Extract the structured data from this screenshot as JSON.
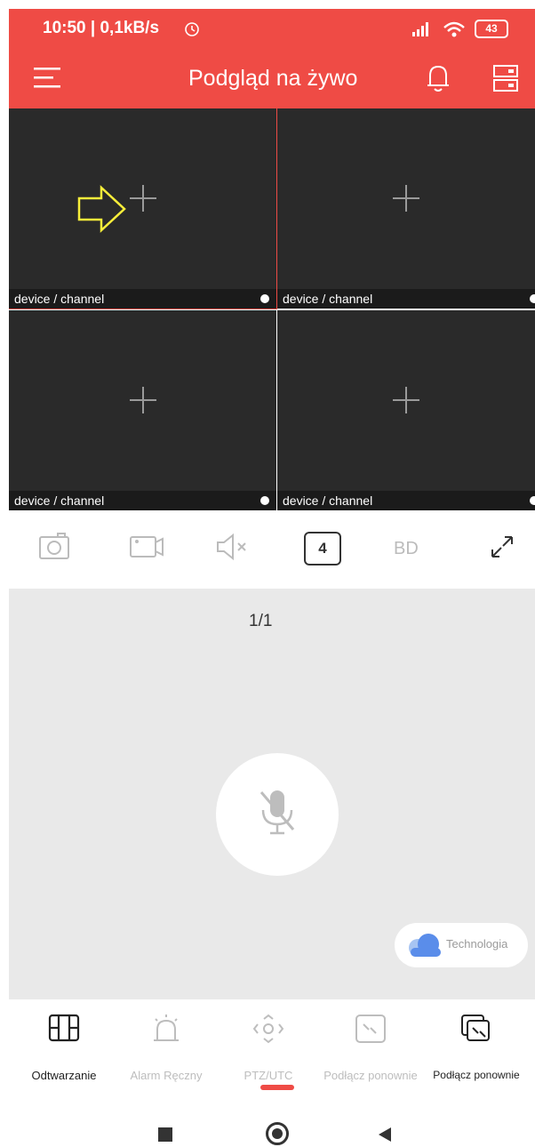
{
  "status_bar": {
    "time": "10:50 | 0,1kB/s",
    "battery": "43"
  },
  "app_bar": {
    "title": "Podgląd na żywo"
  },
  "grid": {
    "cells": [
      {
        "label": "device / channel"
      },
      {
        "label": "device / channel"
      },
      {
        "label": "device / channel"
      },
      {
        "label": "device / channel"
      }
    ]
  },
  "toolbar": {
    "split_count": "4",
    "quality": "BD"
  },
  "main": {
    "page_indicator": "1/1",
    "technology_label": "Technologia"
  },
  "bottom_nav": {
    "items": [
      {
        "label": "Odtwarzanie",
        "icon": "film-icon"
      },
      {
        "label": "Alarm Ręczny",
        "icon": "alarm-icon"
      },
      {
        "label": "PTZ/UTC",
        "icon": "ptz-icon"
      },
      {
        "label": "Podłącz ponownie",
        "icon": "link-icon"
      },
      {
        "label": "Podłącz ponownie",
        "icon": "reconnect-icon"
      }
    ]
  },
  "colors": {
    "accent": "#ef4b45",
    "cell_bg": "#2a2a2a",
    "arrow": "#f7ee3a"
  }
}
